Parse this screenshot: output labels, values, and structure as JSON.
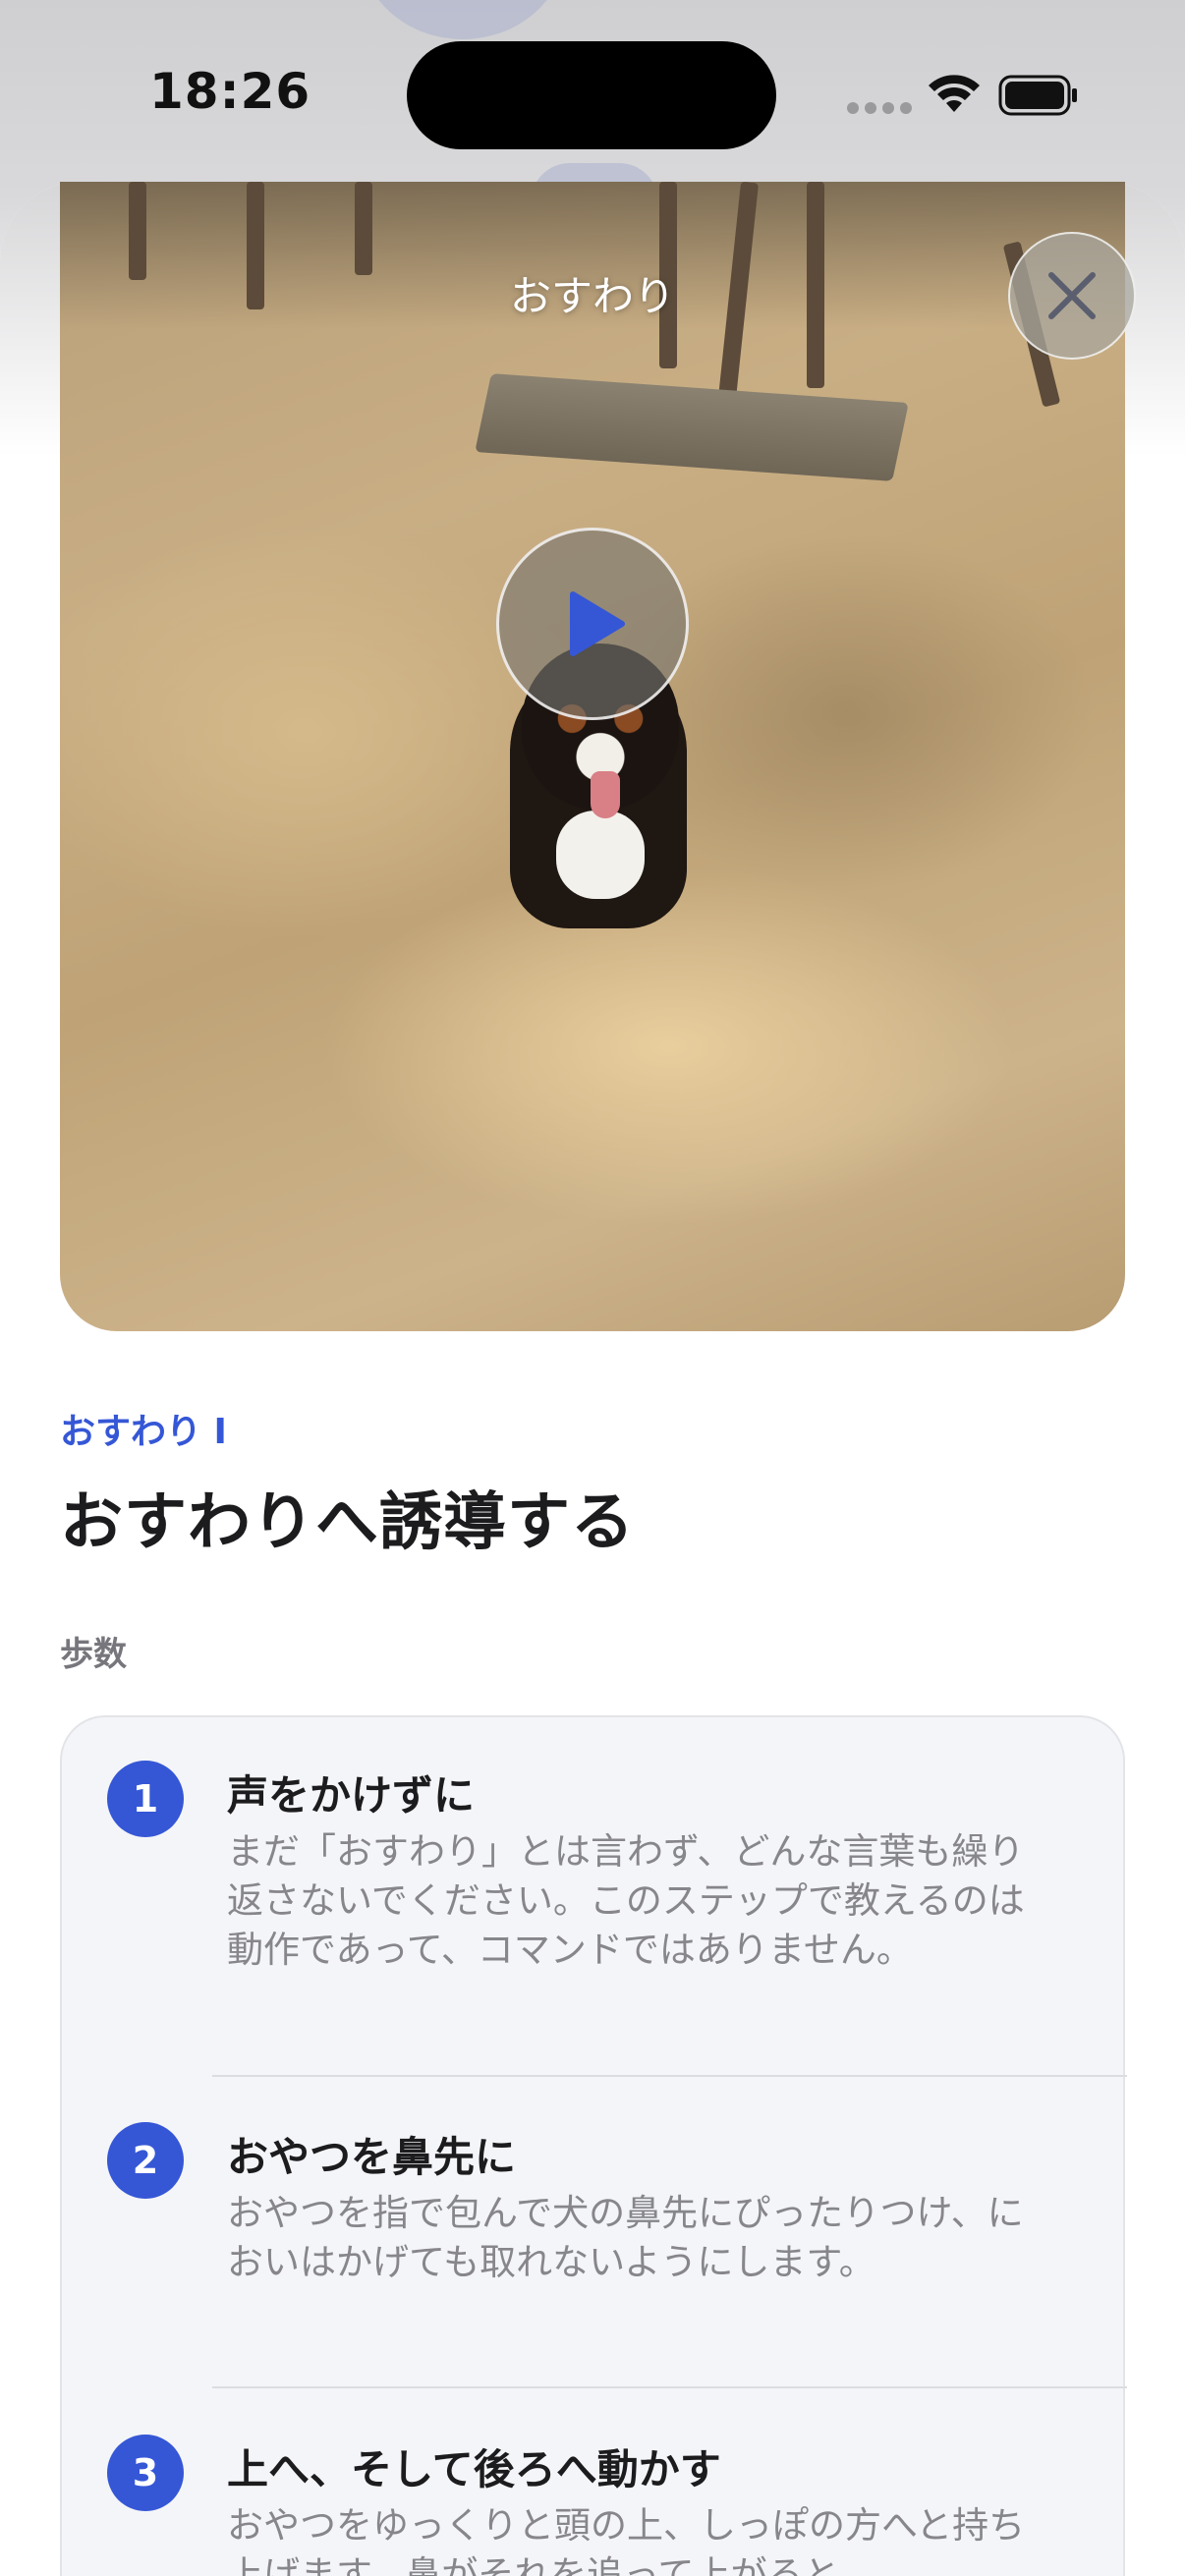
{
  "status_bar": {
    "time": "18:26"
  },
  "video": {
    "title": "おすわり",
    "close_icon": "xmark-icon",
    "play_icon": "play-icon"
  },
  "lesson": {
    "label": "おすわり I",
    "title": "おすわりへ誘導する"
  },
  "steps_section": {
    "label": "歩数",
    "steps": [
      {
        "number": "1",
        "title": "声をかけずに",
        "body": "まだ「おすわり」とは言わず、どんな言葉も繰り返さないでください。このステップで教えるのは動作であって、コマンドではありません。"
      },
      {
        "number": "2",
        "title": "おやつを鼻先に",
        "body": "おやつを指で包んで犬の鼻先にぴったりつけ、においはかげても取れないようにします。"
      },
      {
        "number": "3",
        "title": "上へ、そして後ろへ動かす",
        "body": "おやつをゆっくりと頭の上、しっぽの方へと持ち上げます。鼻がそれを追って上がると"
      }
    ]
  },
  "colors": {
    "accent": "#3557d6",
    "card_bg": "#f4f5f8",
    "secondary_text": "#86868b"
  }
}
